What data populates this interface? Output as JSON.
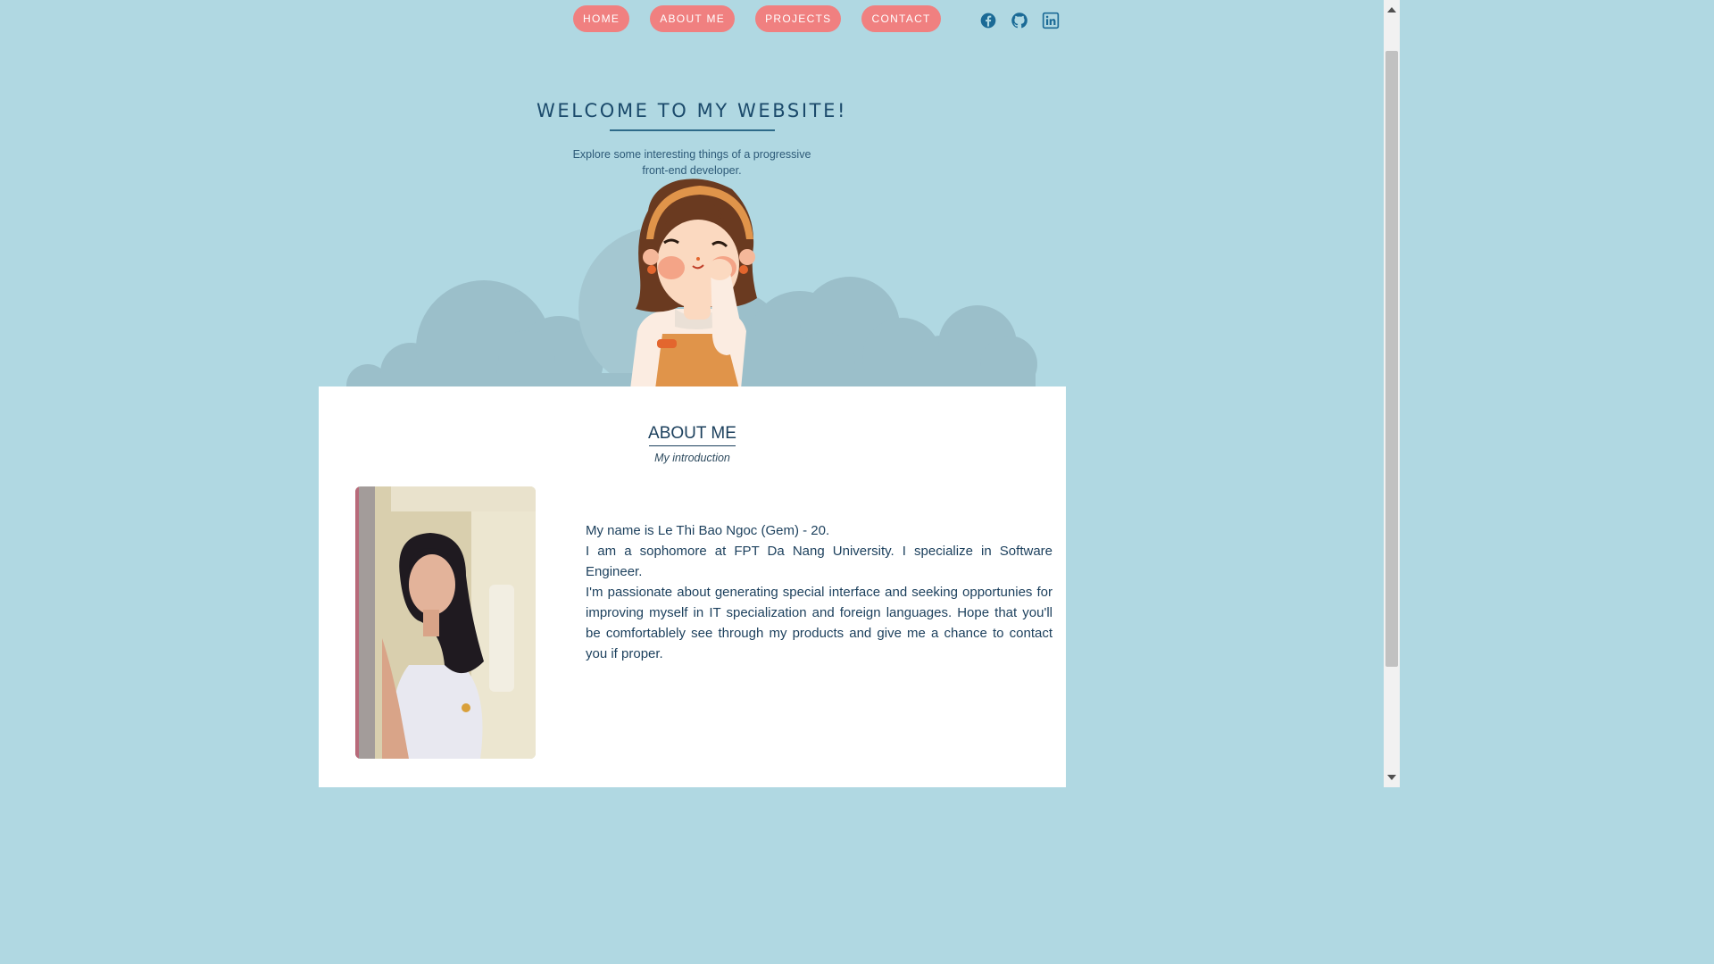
{
  "nav": {
    "items": [
      {
        "label": "HOME"
      },
      {
        "label": "ABOUT ME"
      },
      {
        "label": "PROJECTS"
      },
      {
        "label": "CONTACT"
      }
    ],
    "socials": [
      "facebook-icon",
      "github-icon",
      "linkedin-icon"
    ]
  },
  "hero": {
    "title": "WELCOME TO MY WEBSITE!",
    "subtitle": "Explore some interesting things of a progressive front-end developer."
  },
  "about": {
    "title": "ABOUT ME",
    "subtitle": "My introduction",
    "bio": [
      "My name is Le Thi Bao Ngoc (Gem) - 20.",
      "I am a sophomore at FPT Da Nang University. I specialize in Software Engineer.",
      "I'm passionate about generating special interface and seeking opportunies for improving myself in IT specialization and foreign languages. Hope that you'll be comfortablely see through my products and give me a chance to contact you if proper."
    ]
  },
  "colors": {
    "background": "#b0d8e2",
    "nav_button": "#f08080",
    "heading": "#1b4a6b",
    "icon": "#1b6a96"
  }
}
